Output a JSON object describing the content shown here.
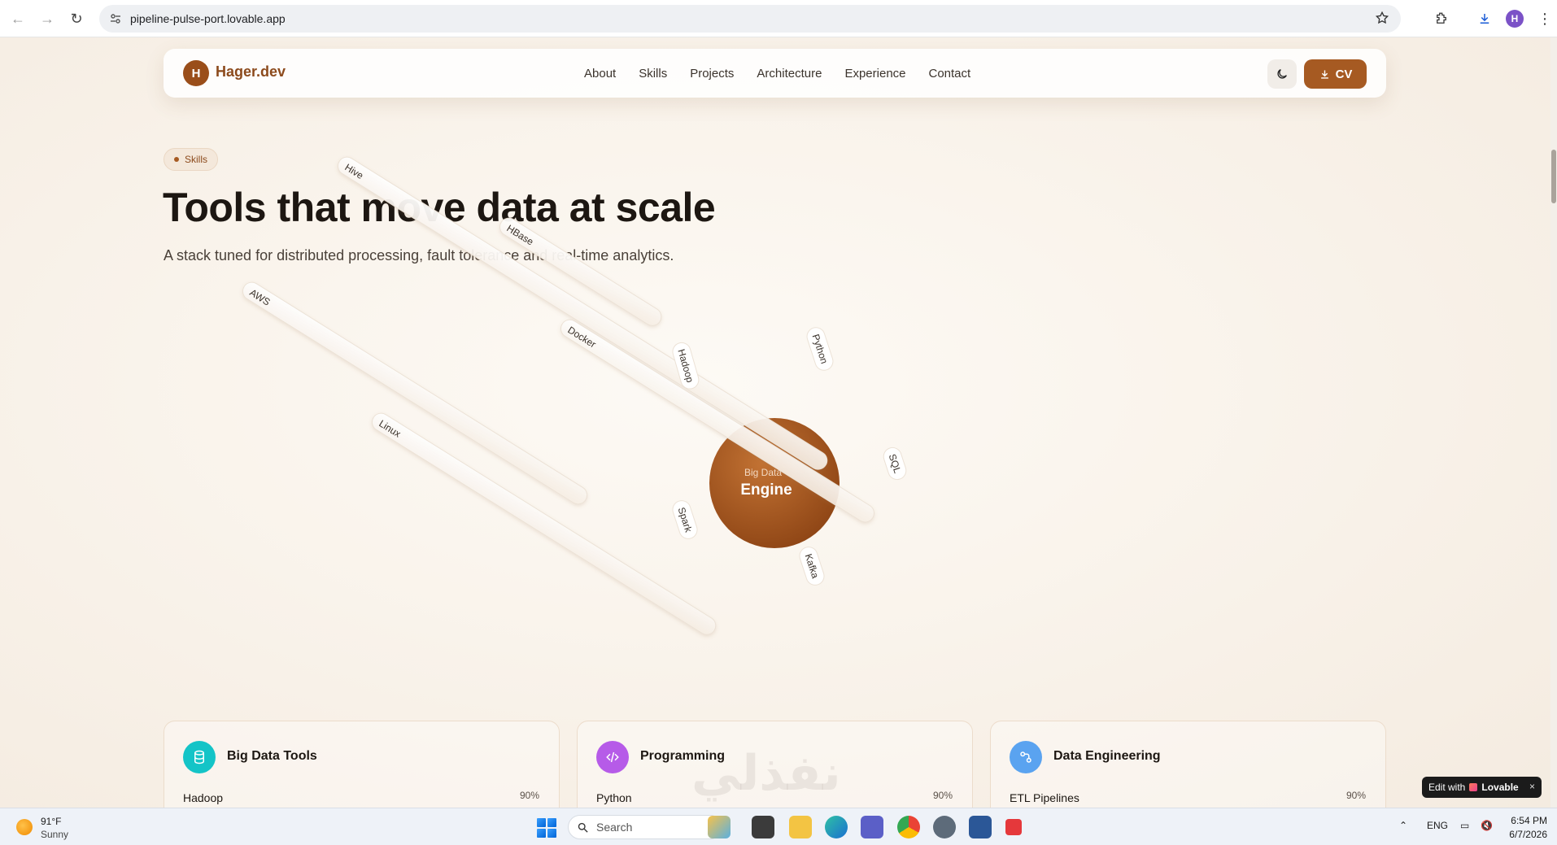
{
  "browser": {
    "url": "pipeline-pulse-port.lovable.app",
    "profile_initial": "H"
  },
  "nav": {
    "logo_initial": "H",
    "logo_text": "Hager.dev",
    "links": [
      "About",
      "Skills",
      "Projects",
      "Architecture",
      "Experience",
      "Contact"
    ],
    "cv_label": "CV"
  },
  "hero": {
    "pill": "Skills",
    "title": "Tools that move data at scale",
    "subtitle": "A stack tuned for distributed processing, fault tolerance and real-time analytics."
  },
  "orbit": {
    "center_small": "Big Data",
    "center_big": "Engine",
    "tags": [
      "Hive",
      "HBase",
      "AWS",
      "Docker",
      "Hadoop",
      "Python",
      "Linux",
      "SQL",
      "Spark",
      "Kafka"
    ]
  },
  "cards": [
    {
      "title": "Big Data Tools",
      "skill": "Hadoop",
      "percent": "90%",
      "icon": "database-icon",
      "color": "#14c4c7"
    },
    {
      "title": "Programming",
      "skill": "Python",
      "percent": "90%",
      "icon": "code-icon",
      "color": "#b65be8"
    },
    {
      "title": "Data Engineering",
      "skill": "ETL Pipelines",
      "percent": "90%",
      "icon": "workflow-icon",
      "color": "#5aa3f0"
    }
  ],
  "watermark": "نفذلي",
  "lovable": {
    "prefix": "Edit with",
    "brand": "Lovable",
    "close": "×"
  },
  "taskbar": {
    "temp": "91°F",
    "condition": "Sunny",
    "search": "Search",
    "lang": "ENG",
    "time": "6:54 PM",
    "date": "6/7/2026"
  },
  "colors": {
    "accent": "#a65a22",
    "background": "#fbf6ef"
  }
}
